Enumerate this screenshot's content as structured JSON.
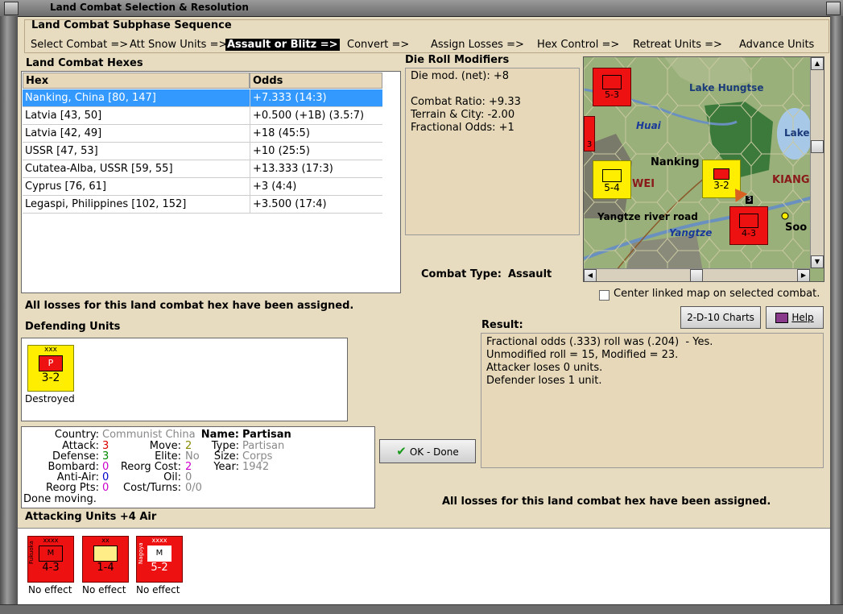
{
  "window": {
    "title": "Land Combat Selection & Resolution"
  },
  "subphase": {
    "heading": "Land Combat Subphase Sequence",
    "steps": [
      "Select Combat =>",
      "Att Snow Units =>",
      "Assault or Blitz =>",
      "Convert =>",
      "Assign Losses =>",
      "Hex Control =>",
      "Retreat Units =>",
      "Advance Units"
    ],
    "active_index": 2
  },
  "hexes": {
    "heading": "Land Combat Hexes",
    "columns": [
      "Hex",
      "Odds"
    ],
    "rows": [
      {
        "hex": "Nanking, China [80, 147]",
        "odds": "+7.333 (14:3)"
      },
      {
        "hex": "Latvia [43, 50]",
        "odds": "+0.500 (+1B) (3.5:7)"
      },
      {
        "hex": "Latvia [42, 49]",
        "odds": "+18 (45:5)"
      },
      {
        "hex": "USSR [47, 53]",
        "odds": "+10 (25:5)"
      },
      {
        "hex": "Cutatea-Alba, USSR [59, 55]",
        "odds": "+13.333 (17:3)"
      },
      {
        "hex": "Cyprus [76, 61]",
        "odds": "+3 (4:4)"
      },
      {
        "hex": "Legaspi, Philippines [102, 152]",
        "odds": "+3.500 (17:4)"
      }
    ],
    "selected_index": 0
  },
  "die_roll": {
    "heading": "Die Roll Modifiers",
    "lines": [
      "Die mod. (net): +8",
      "",
      "Combat Ratio: +9.33",
      "Terrain & City: -2.00",
      "Fractional Odds: +1"
    ]
  },
  "combat_type": {
    "label": "Combat Type:",
    "value": "Assault"
  },
  "map": {
    "labels": {
      "lake_hungtse": "Lake Hungtse",
      "huai": "Huai",
      "lake": "Lake",
      "nanking": "Nanking",
      "wei": "WEI",
      "kiang": "KIANG",
      "yangtze_road": "Yangtze river road",
      "yangtze": "Yangtze",
      "soo": "Soo"
    },
    "counters": [
      {
        "text": "5-3"
      },
      {
        "text": "3"
      },
      {
        "text": "5-4"
      },
      {
        "text": "3-2"
      },
      {
        "text": "4-3"
      }
    ],
    "stack_number": "3",
    "center_linked_label": "Center linked map on selected combat."
  },
  "losses_msg_top": "All losses for this land combat hex have been assigned.",
  "buttons": {
    "charts": "2-D-10 Charts",
    "help": "Help",
    "ok": "OK - Done"
  },
  "result": {
    "heading": "Result:",
    "lines": [
      "Fractional odds (.333) roll was (.204)  - Yes.",
      "Unmodified roll = 15, Modified = 23.",
      "Attacker loses 0 units.",
      "Defender loses 1 unit."
    ]
  },
  "defending": {
    "heading": "Defending Units",
    "units": [
      {
        "size": "xxx",
        "letter": "P",
        "strength": "3-2",
        "status": "Destroyed"
      }
    ]
  },
  "unit_info": {
    "country_label": "Country:",
    "country": "Communist China",
    "attack_label": "Attack:",
    "attack": "3",
    "defense_label": "Defense:",
    "defense": "3",
    "bombard_label": "Bombard:",
    "bombard": "0",
    "antiair_label": "Anti-Air:",
    "antiair": "0",
    "reorg_pts_label": "Reorg Pts:",
    "reorg_pts": "0",
    "move_label": "Move:",
    "move": "2",
    "elite_label": "Elite:",
    "elite": "No",
    "reorg_cost_label": "Reorg Cost:",
    "reorg_cost": "2",
    "oil_label": "Oil:",
    "oil": "0",
    "cost_turns_label": "Cost/Turns:",
    "cost_turns": "0/0",
    "name_label": "Name:",
    "name": "Partisan",
    "type_label": "Type:",
    "type": "Partisan",
    "size_label": "Size:",
    "size": "Corps",
    "year_label": "Year:",
    "year": "1942",
    "done_moving": "Done moving."
  },
  "losses_msg_bottom": "All losses for this land combat hex have been assigned.",
  "attacking": {
    "heading": "Attacking Units +4 Air",
    "units": [
      {
        "size": "xxxx",
        "letter": "M",
        "side": "Fukuoka",
        "strength": "4-3",
        "status": "No effect"
      },
      {
        "size": "xx",
        "letter": "",
        "side": "",
        "strength": "1-4",
        "status": "No effect"
      },
      {
        "size": "xxxx",
        "letter": "M",
        "side": "Nagoya",
        "strength": "5-2",
        "status": "No effect"
      }
    ]
  },
  "colors": {
    "panel": "#e6d8b8",
    "selection": "#3399ff",
    "attacker_red": "#ee1111",
    "defender_yellow": "#ffee00"
  }
}
